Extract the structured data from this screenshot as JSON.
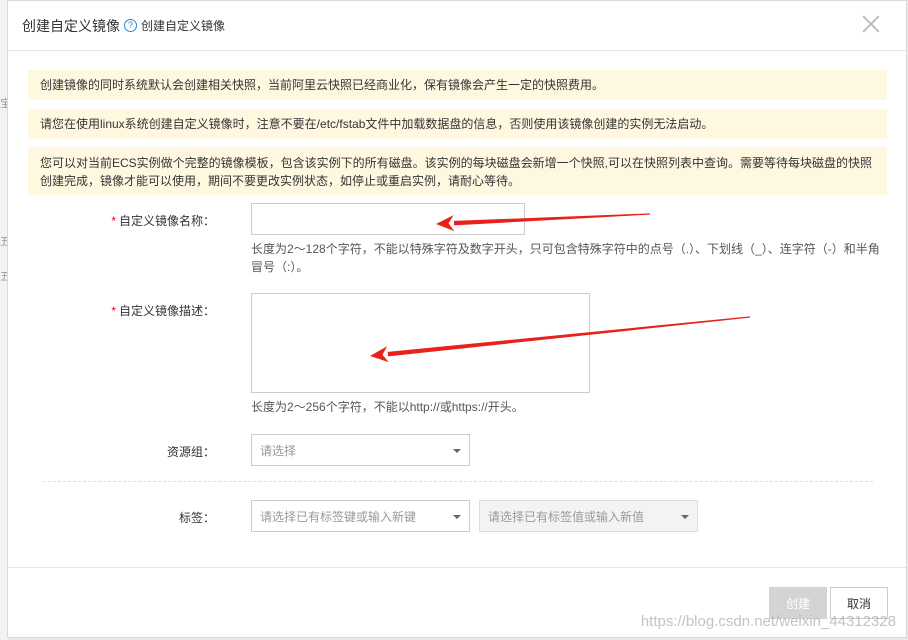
{
  "backdrop": {
    "glyphs": [
      "宝",
      "五",
      "五"
    ]
  },
  "dialog": {
    "title": "创建自定义镜像",
    "help_icon": "question-circle-icon",
    "help_text": "创建自定义镜像"
  },
  "notices": [
    "创建镜像的同时系统默认会创建相关快照，当前阿里云快照已经商业化，保有镜像会产生一定的快照费用。",
    "请您在使用linux系统创建自定义镜像时，注意不要在/etc/fstab文件中加载数据盘的信息，否则使用该镜像创建的实例无法启动。",
    "您可以对当前ECS实例做个完整的镜像模板，包含该实例下的所有磁盘。该实例的每块磁盘会新增一个快照,可以在快照列表中查询。需要等待每块磁盘的快照创建完成，镜像才能可以使用，期间不要更改实例状态，如停止或重启实例，请耐心等待。"
  ],
  "form": {
    "required_mark": "*",
    "name": {
      "label": "自定义镜像名称：",
      "value": "",
      "hint": "长度为2～128个字符，不能以特殊字符及数字开头，只可包含特殊字符中的点号（.）、下划线（_）、连字符（-）和半角冒号（:）。"
    },
    "description": {
      "label": "自定义镜像描述：",
      "value": "",
      "hint": "长度为2～256个字符，不能以http://或https://开头。"
    },
    "resource_group": {
      "label": "资源组：",
      "placeholder": "请选择"
    },
    "tags": {
      "label": "标签：",
      "key_placeholder": "请选择已有标签键或输入新键",
      "value_placeholder": "请选择已有标签值或输入新值"
    }
  },
  "footer": {
    "create_label": "创建",
    "cancel_label": "取消"
  },
  "annotations": {
    "arrow_color": "#e8211b"
  },
  "watermark": "https://blog.csdn.net/weixin_44312328"
}
